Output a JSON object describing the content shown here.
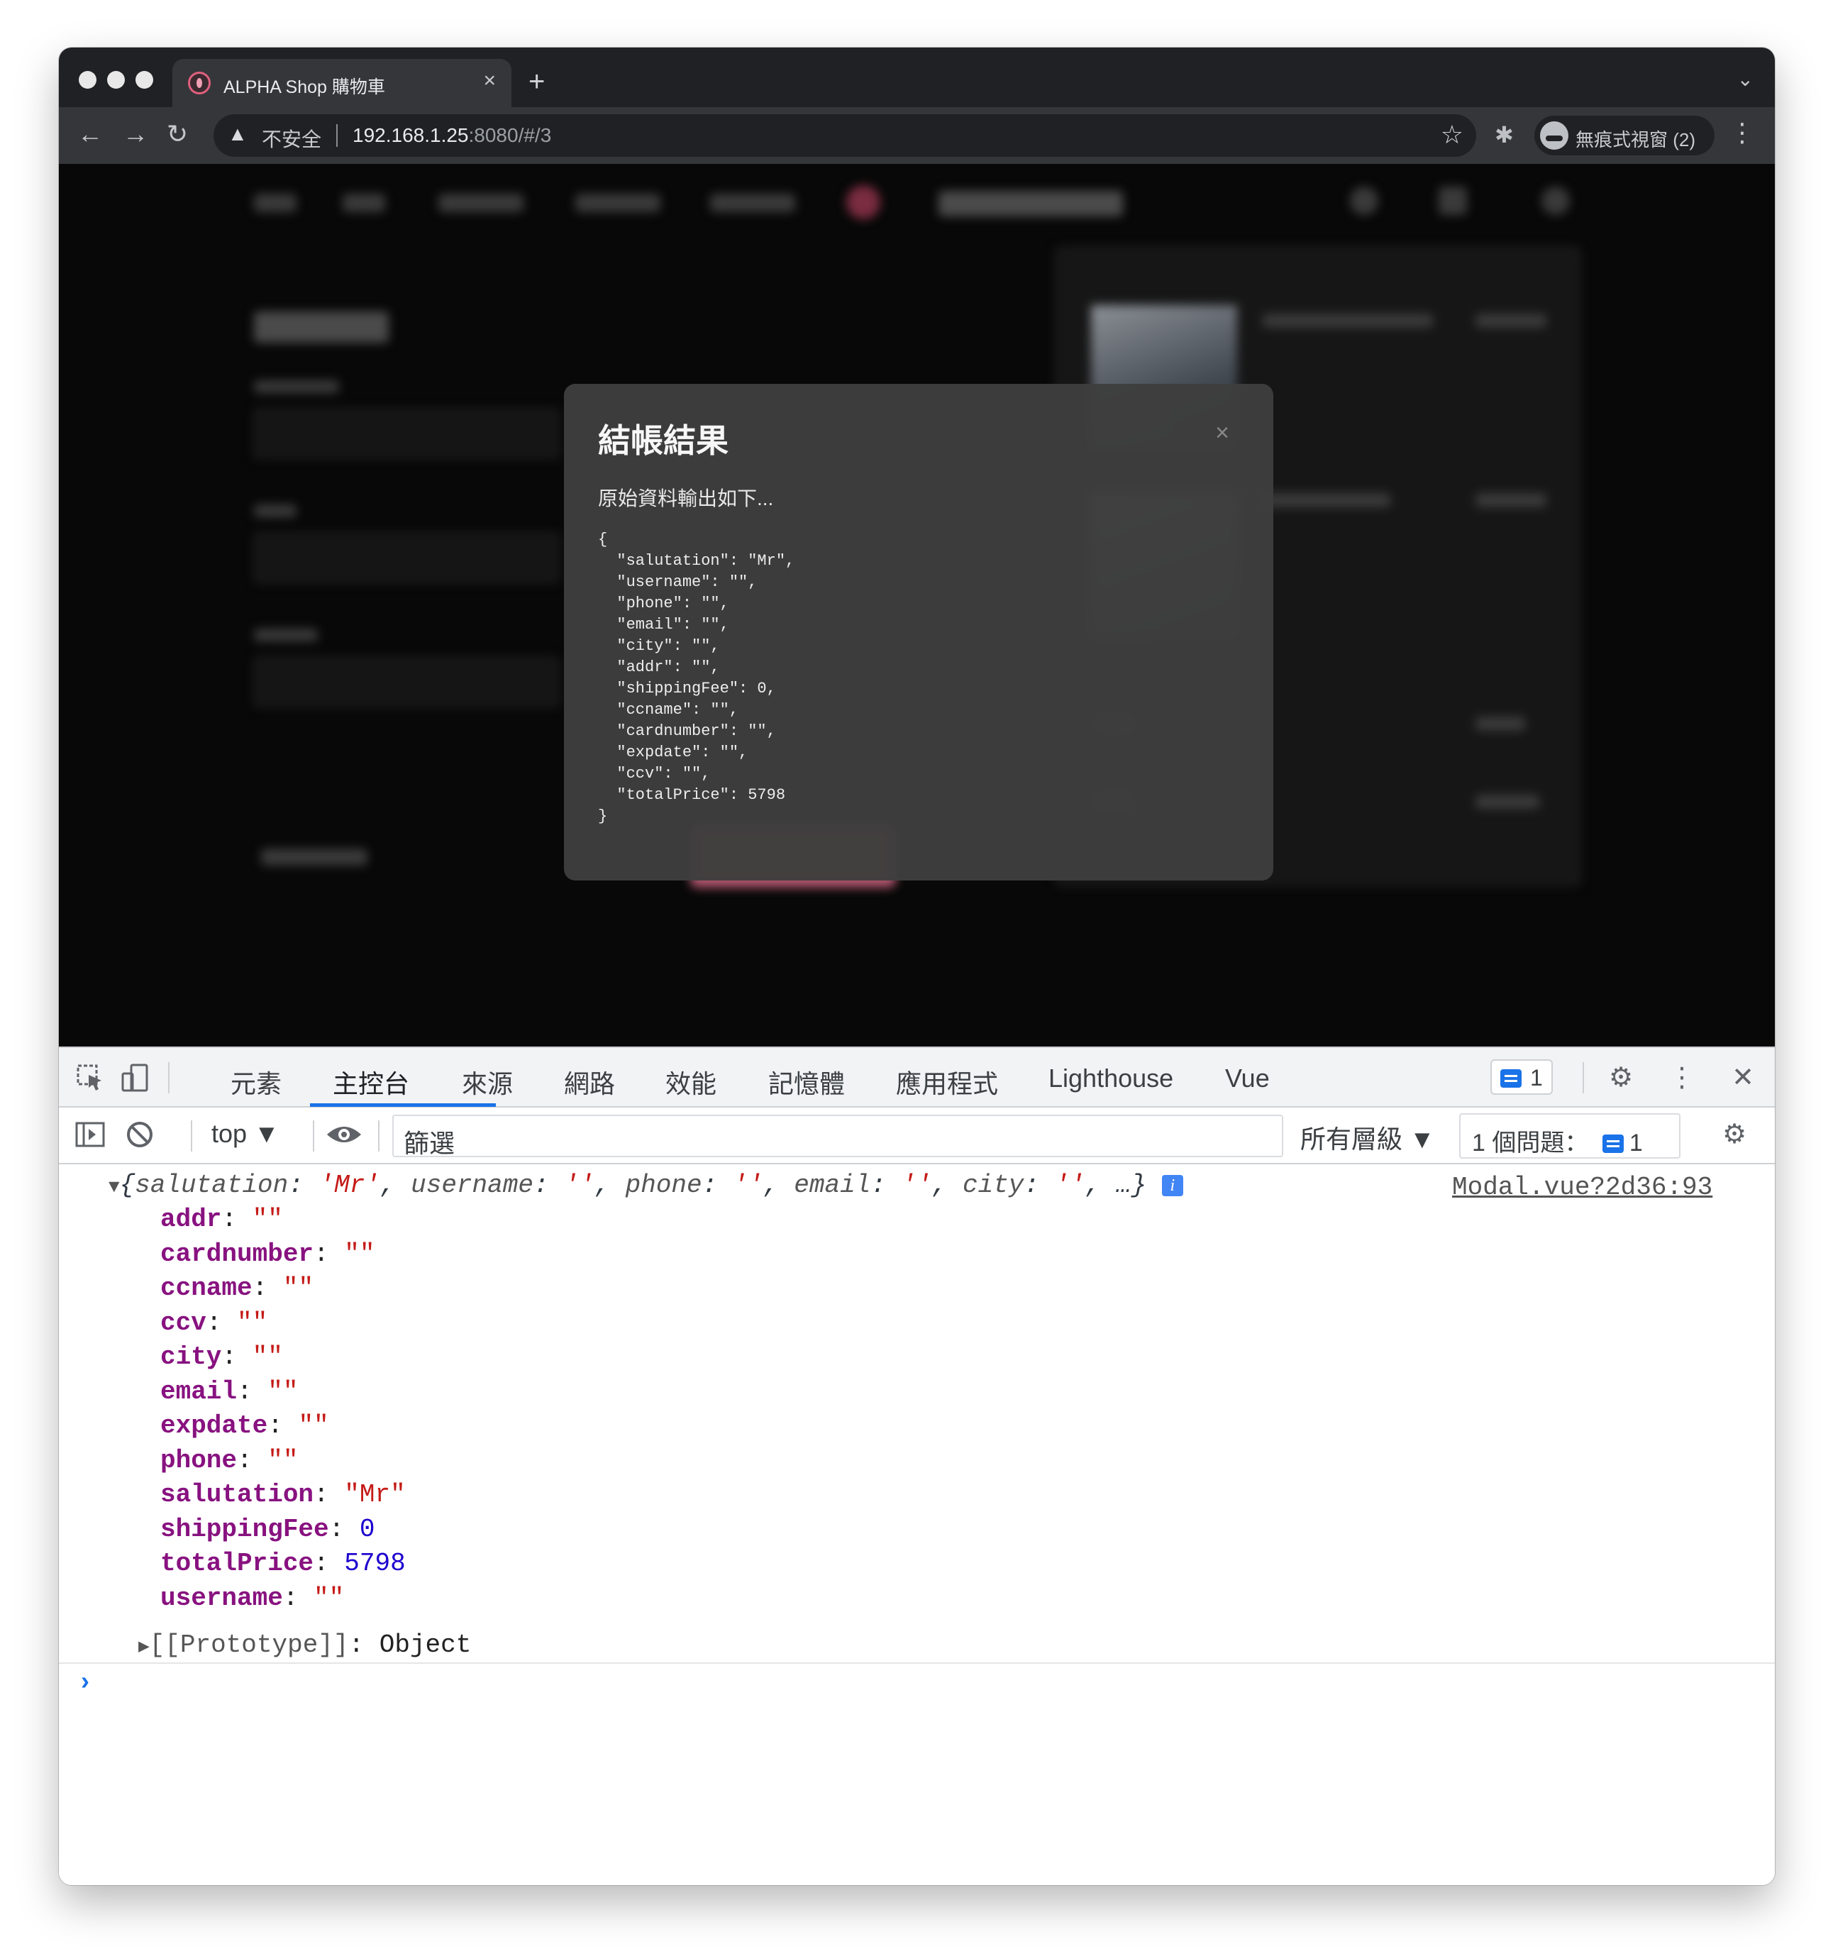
{
  "browser": {
    "tab_title": "ALPHA Shop 購物車",
    "tab_close": "×",
    "new_tab": "+",
    "tab_menu": "⌄",
    "back": "←",
    "forward": "→",
    "reload": "↻",
    "security_icon": "▲",
    "security_label": "不安全",
    "url_host": "192.168.1.25",
    "url_rest": ":8080/#/3",
    "bookmark": "☆",
    "extensions": "✱",
    "incognito_label": "無痕式視窗 (2)",
    "menu": "⋮"
  },
  "modal": {
    "title": "結帳結果",
    "close": "×",
    "subtitle": "原始資料輸出如下...",
    "raw_output": "{\n  \"salutation\": \"Mr\",\n  \"username\": \"\",\n  \"phone\": \"\",\n  \"email\": \"\",\n  \"city\": \"\",\n  \"addr\": \"\",\n  \"shippingFee\": 0,\n  \"ccname\": \"\",\n  \"cardnumber\": \"\",\n  \"expdate\": \"\",\n  \"ccv\": \"\",\n  \"totalPrice\": 5798\n}"
  },
  "devtools": {
    "tabs": [
      "元素",
      "主控台",
      "來源",
      "網路",
      "效能",
      "記憶體",
      "應用程式",
      "Lighthouse",
      "Vue"
    ],
    "active_tab": "主控台",
    "message_badge_count": "1",
    "gear": "⚙",
    "kebab": "⋮",
    "close": "✕",
    "context": "top ▼",
    "eye": "👁",
    "filter_placeholder": "篩選",
    "levels": "所有層級 ▼",
    "issues_label": "1 個問題：",
    "issues_count": "1"
  },
  "console": {
    "source_link": "Modal.vue?2d36:93",
    "summary": {
      "open": "{",
      "k1": "salutation",
      "v1": "'Mr'",
      "k2": "username",
      "v2": "''",
      "k3": "phone",
      "v3": "''",
      "k4": "email",
      "v4": "''",
      "k5": "city",
      "v5": "''",
      "tail": ", …}"
    },
    "properties": [
      {
        "key": "addr",
        "value": "\"\"",
        "kind": "str"
      },
      {
        "key": "cardnumber",
        "value": "\"\"",
        "kind": "str"
      },
      {
        "key": "ccname",
        "value": "\"\"",
        "kind": "str"
      },
      {
        "key": "ccv",
        "value": "\"\"",
        "kind": "str"
      },
      {
        "key": "city",
        "value": "\"\"",
        "kind": "str"
      },
      {
        "key": "email",
        "value": "\"\"",
        "kind": "str"
      },
      {
        "key": "expdate",
        "value": "\"\"",
        "kind": "str"
      },
      {
        "key": "phone",
        "value": "\"\"",
        "kind": "str"
      },
      {
        "key": "salutation",
        "value": "\"Mr\"",
        "kind": "str"
      },
      {
        "key": "shippingFee",
        "value": "0",
        "kind": "num"
      },
      {
        "key": "totalPrice",
        "value": "5798",
        "kind": "num"
      },
      {
        "key": "username",
        "value": "\"\"",
        "kind": "str"
      }
    ],
    "prototype": "[[Prototype]]",
    "prototype_value": "Object",
    "prompt": "›"
  }
}
